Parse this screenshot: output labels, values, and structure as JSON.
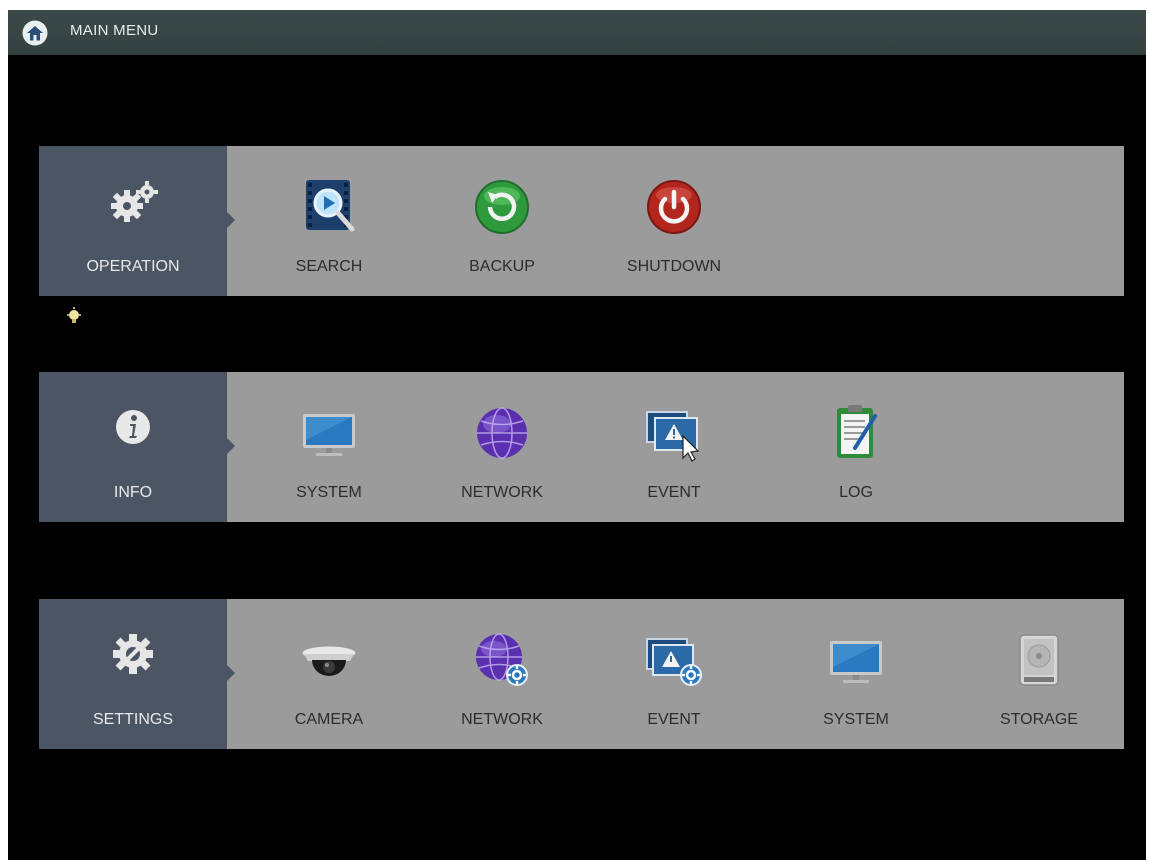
{
  "title": "MAIN MENU",
  "sections": {
    "operation": {
      "label": "OPERATION",
      "items": [
        {
          "label": "SEARCH",
          "icon": "search-video-icon"
        },
        {
          "label": "BACKUP",
          "icon": "backup-icon"
        },
        {
          "label": "SHUTDOWN",
          "icon": "power-icon"
        }
      ]
    },
    "info": {
      "label": "INFO",
      "items": [
        {
          "label": "SYSTEM",
          "icon": "monitor-icon"
        },
        {
          "label": "NETWORK",
          "icon": "globe-icon"
        },
        {
          "label": "EVENT",
          "icon": "event-alert-icon"
        },
        {
          "label": "LOG",
          "icon": "clipboard-log-icon"
        }
      ]
    },
    "settings": {
      "label": "SETTINGS",
      "items": [
        {
          "label": "CAMERA",
          "icon": "dome-camera-icon"
        },
        {
          "label": "NETWORK",
          "icon": "globe-gear-icon"
        },
        {
          "label": "EVENT",
          "icon": "event-gear-icon"
        },
        {
          "label": "SYSTEM",
          "icon": "monitor-icon"
        },
        {
          "label": "STORAGE",
          "icon": "hard-drive-icon"
        }
      ]
    }
  },
  "colors": {
    "titlebar": "#3b4a48",
    "category_bg": "#4c5563",
    "panel_bg": "#9b9b9b",
    "backup_green": "#2e9a3c",
    "shutdown_red": "#b3261e",
    "network_purple": "#5a2fb0"
  }
}
